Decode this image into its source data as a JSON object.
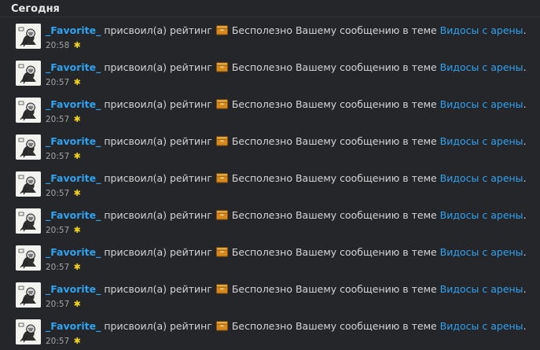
{
  "header": {
    "title": "Сегодня"
  },
  "items": [
    {
      "user": "_Favorite_",
      "action": "присвоил(а) рейтинг",
      "rating": "Бесполезно",
      "text": "Вашему сообщению в теме",
      "topic": "Видосы с арены",
      "end": ".",
      "time": "20:58",
      "icon": "rating-box-icon",
      "marker": "yellow-star-icon"
    },
    {
      "user": "_Favorite_",
      "action": "присвоил(а) рейтинг",
      "rating": "Бесполезно",
      "text": "Вашему сообщению в теме",
      "topic": "Видосы с арены",
      "end": ".",
      "time": "20:57",
      "icon": "rating-box-icon",
      "marker": "yellow-star-icon"
    },
    {
      "user": "_Favorite_",
      "action": "присвоил(а) рейтинг",
      "rating": "Бесполезно",
      "text": "Вашему сообщению в теме",
      "topic": "Видосы с арены",
      "end": ".",
      "time": "20:57",
      "icon": "rating-box-icon",
      "marker": "yellow-star-icon"
    },
    {
      "user": "_Favorite_",
      "action": "присвоил(а) рейтинг",
      "rating": "Бесполезно",
      "text": "Вашему сообщению в теме",
      "topic": "Видосы с арены",
      "end": ".",
      "time": "20:57",
      "icon": "rating-box-icon",
      "marker": "yellow-star-icon"
    },
    {
      "user": "_Favorite_",
      "action": "присвоил(а) рейтинг",
      "rating": "Бесполезно",
      "text": "Вашему сообщению в теме",
      "topic": "Видосы с арены",
      "end": ".",
      "time": "20:57",
      "icon": "rating-box-icon",
      "marker": "yellow-star-icon"
    },
    {
      "user": "_Favorite_",
      "action": "присвоил(а) рейтинг",
      "rating": "Бесполезно",
      "text": "Вашему сообщению в теме",
      "topic": "Видосы с арены",
      "end": ".",
      "time": "20:57",
      "icon": "rating-box-icon",
      "marker": "yellow-star-icon"
    },
    {
      "user": "_Favorite_",
      "action": "присвоил(а) рейтинг",
      "rating": "Бесполезно",
      "text": "Вашему сообщению в теме",
      "topic": "Видосы с арены",
      "end": ".",
      "time": "20:57",
      "icon": "rating-box-icon",
      "marker": "yellow-star-icon"
    },
    {
      "user": "_Favorite_",
      "action": "присвоил(а) рейтинг",
      "rating": "Бесполезно",
      "text": "Вашему сообщению в теме",
      "topic": "Видосы с арены",
      "end": ".",
      "time": "20:57",
      "icon": "rating-box-icon",
      "marker": "yellow-star-icon"
    },
    {
      "user": "_Favorite_",
      "action": "присвоил(а) рейтинг",
      "rating": "Бесполезно",
      "text": "Вашему сообщению в теме",
      "topic": "Видосы с арены",
      "end": ".",
      "time": "20:57",
      "icon": "rating-box-icon",
      "marker": "yellow-star-icon"
    }
  ],
  "colors": {
    "background": "#25262a",
    "link": "#2fa2f0",
    "text": "#d4d4d4",
    "time": "#a3a3a3",
    "star": "#f2d21b"
  }
}
